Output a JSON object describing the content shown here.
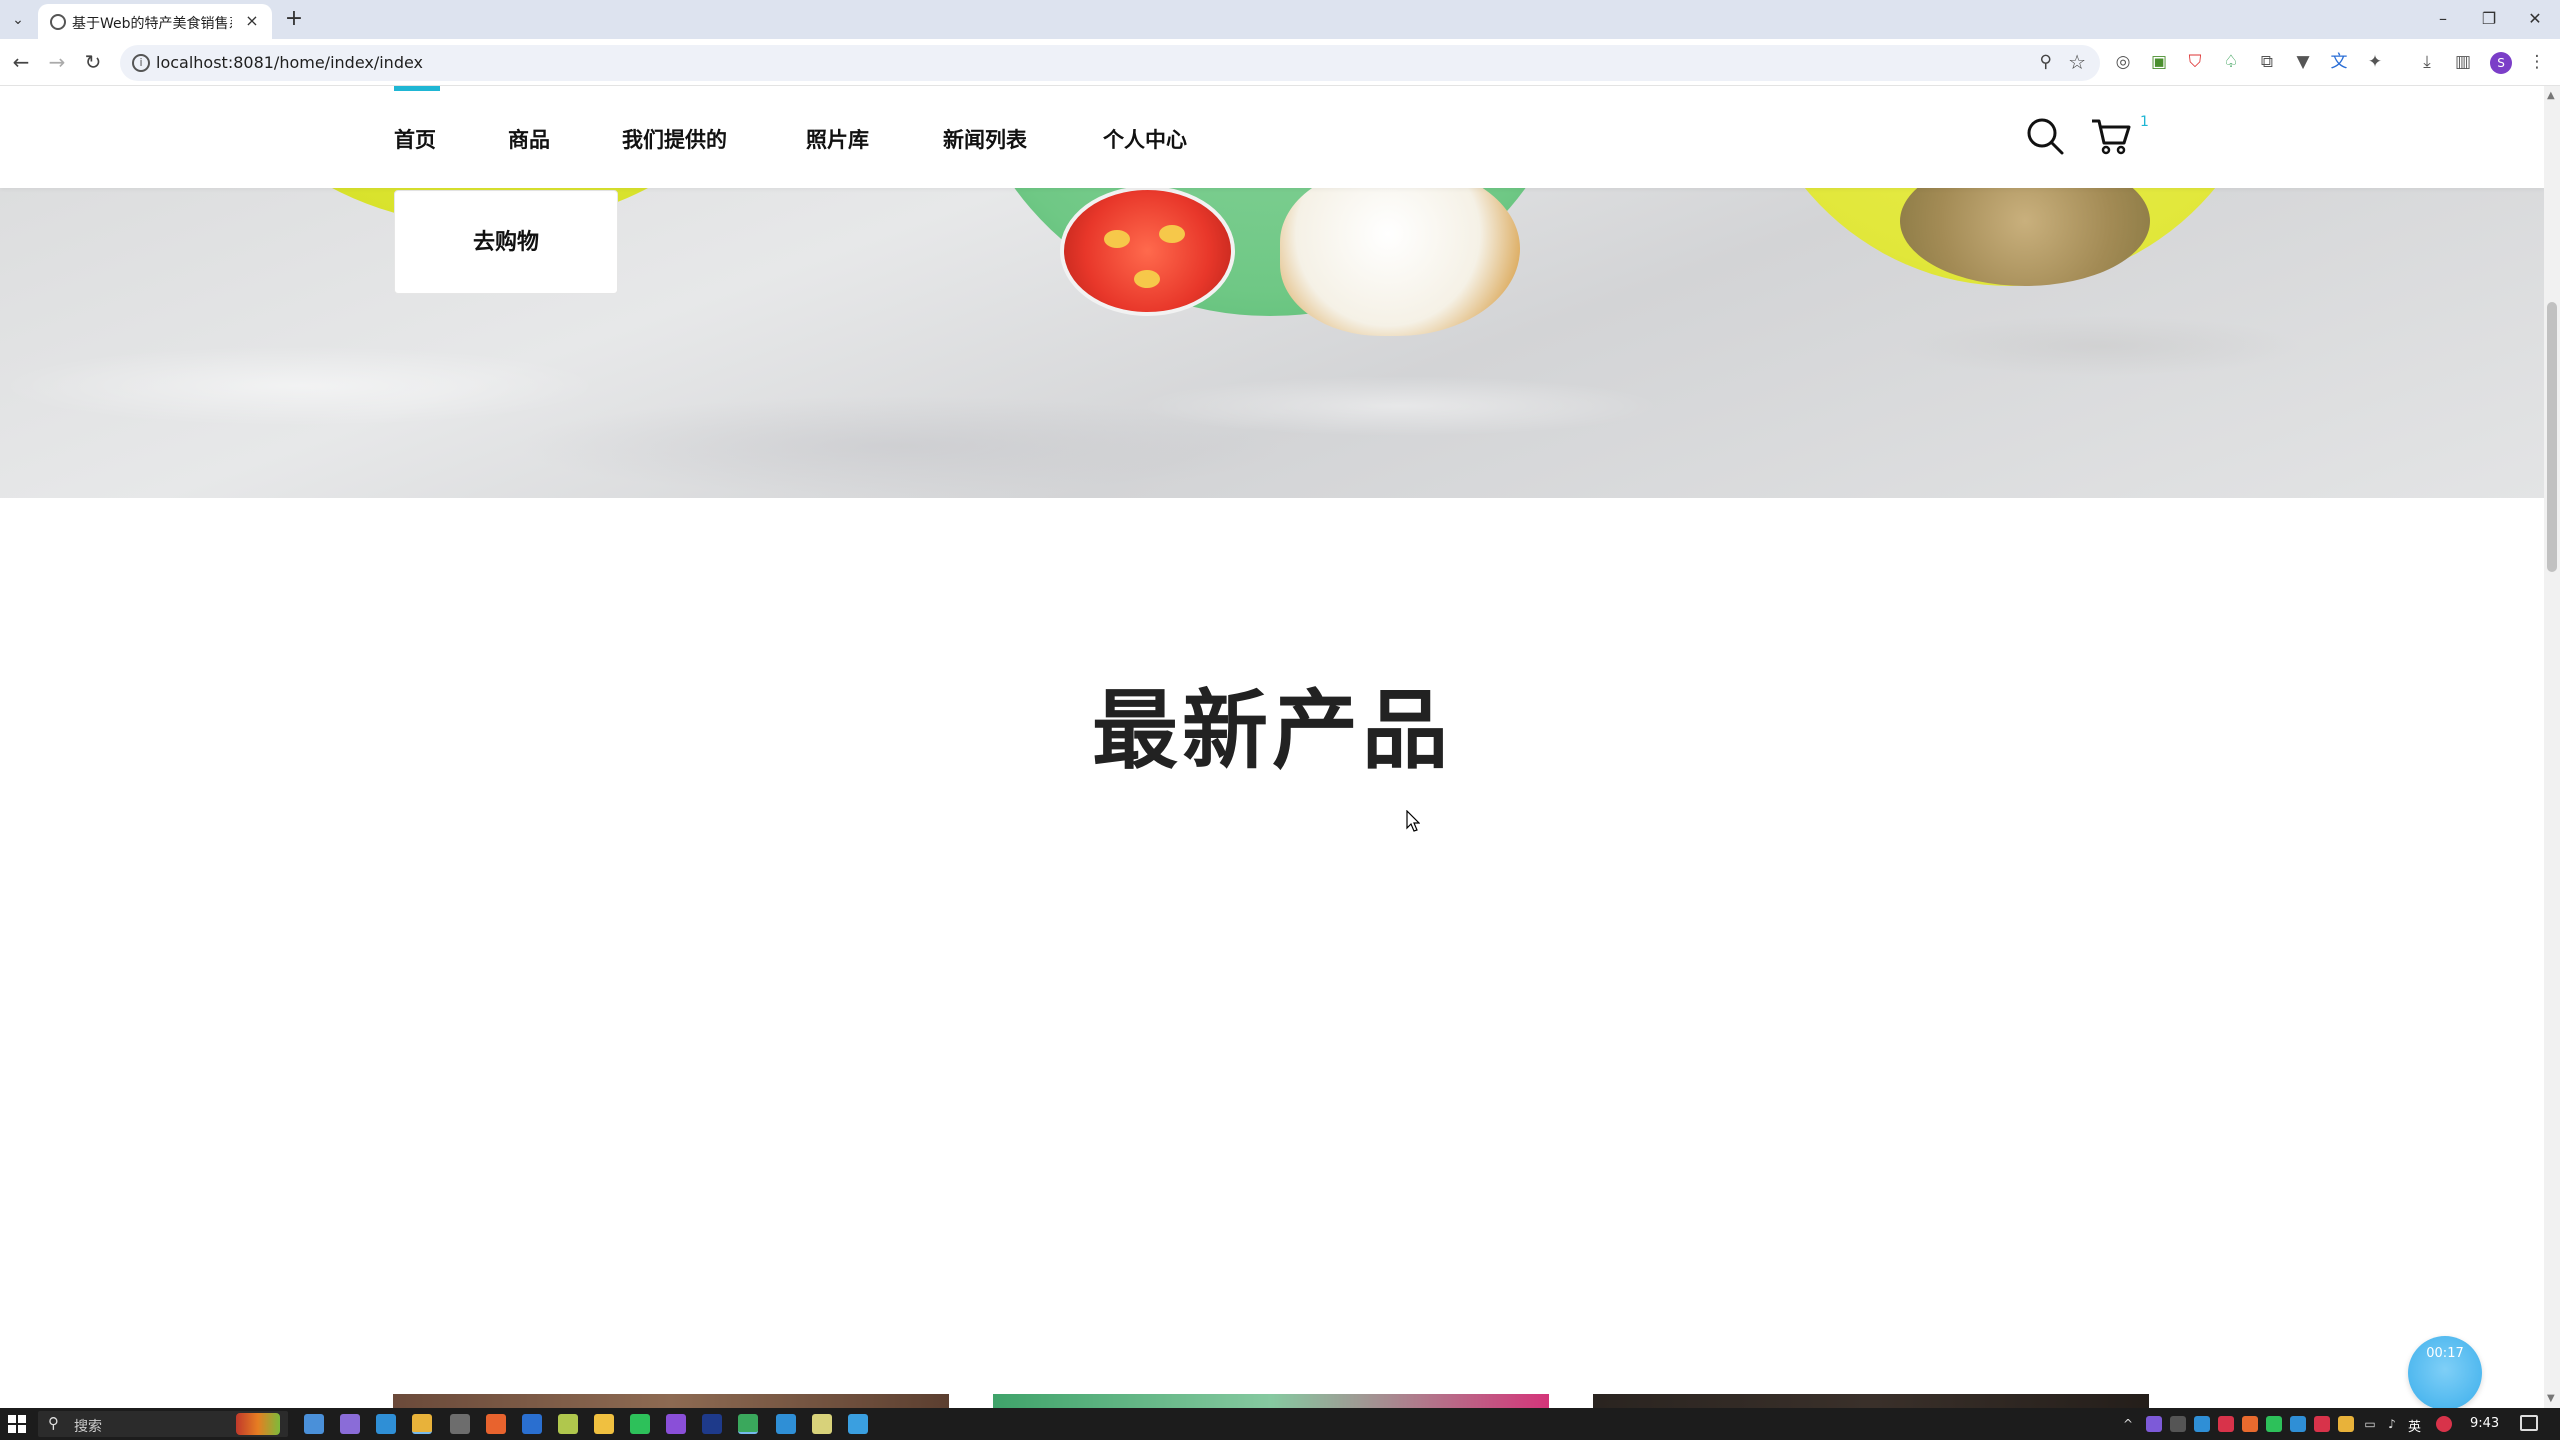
{
  "browser": {
    "tab_title": "基于Web的特产美食销售系统",
    "url": "localhost:8081/home/index/index",
    "profile_initial": "S"
  },
  "site": {
    "nav_items": [
      "首页",
      "商品",
      "我们提供的",
      "照片库",
      "新闻列表",
      "个人中心"
    ],
    "active_nav": "首页",
    "cart_count": "1",
    "accent_color": "#1fb6d4"
  },
  "hero": {
    "shop_button": "去购物"
  },
  "section": {
    "title": "最新产品"
  },
  "overlay": {
    "timer": "00:17"
  },
  "taskbar": {
    "search_placeholder": "搜索",
    "ime": "英",
    "time": "9:43"
  },
  "icons": [
    "tab-list-icon",
    "globe-icon",
    "close-icon",
    "plus-icon",
    "minimize-icon",
    "restore-icon",
    "back-icon",
    "forward-icon",
    "reload-icon",
    "info-icon",
    "zoom-icon",
    "star-icon",
    "search-icon",
    "cart-icon",
    "windows-start-icon"
  ]
}
